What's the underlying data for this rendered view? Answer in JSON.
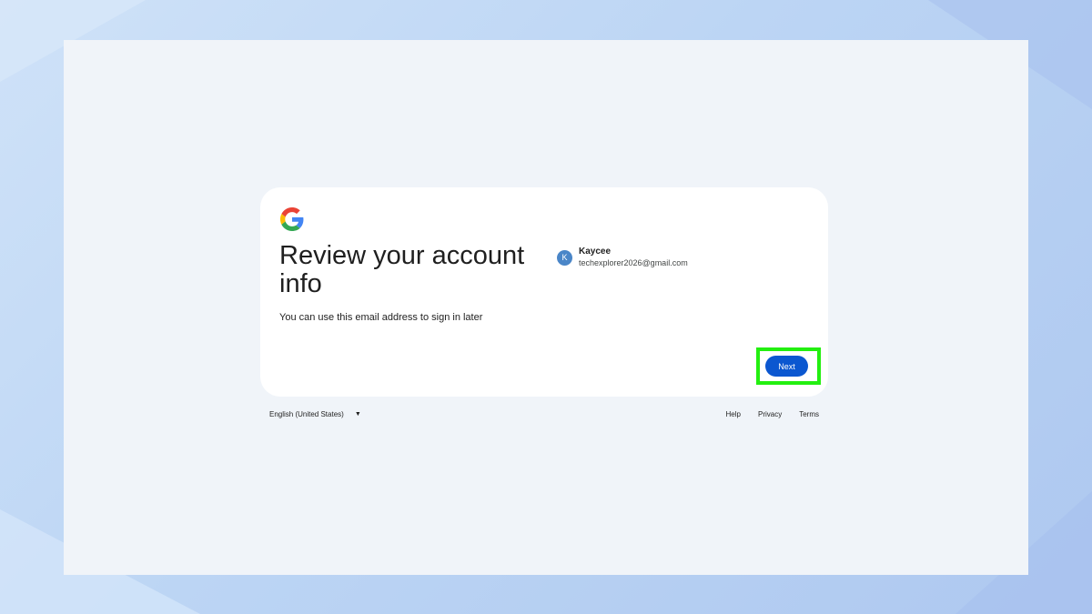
{
  "card": {
    "title": "Review your account info",
    "subtitle": "You can use this email address to sign in later"
  },
  "account": {
    "avatar_letter": "K",
    "name": "Kaycee",
    "email": "techexplorer2026@gmail.com"
  },
  "actions": {
    "next_label": "Next"
  },
  "footer": {
    "language": "English (United States)",
    "links": [
      "Help",
      "Privacy",
      "Terms"
    ]
  },
  "colors": {
    "primary": "#0b57d0",
    "avatar": "#4a86c8",
    "highlight": "#23ef10"
  }
}
